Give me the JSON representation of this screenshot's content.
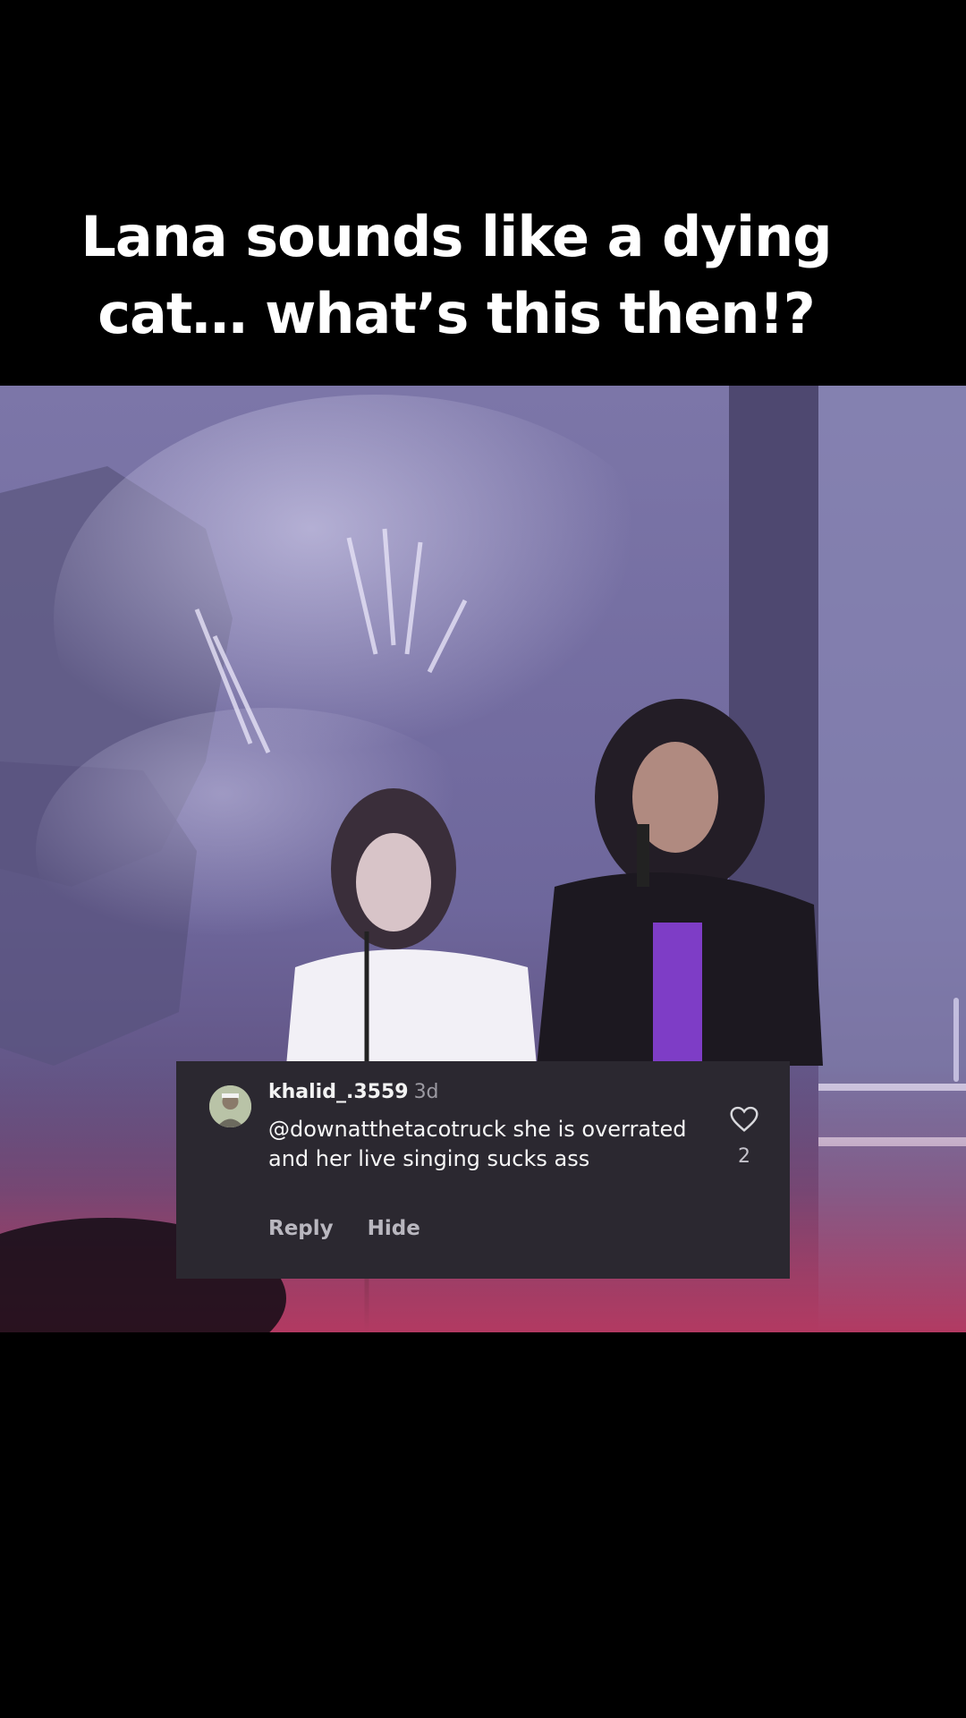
{
  "overlay": {
    "caption": "Lana sounds like a dying cat… what’s this then!?"
  },
  "video": {
    "dominant_color": "#6b6494",
    "description_icon": "concert-video-frame"
  },
  "comment": {
    "username": "khalid_.3559",
    "time": "3d",
    "text": "@downatthetacotruck she is overrated and her live singing sucks ass",
    "reply_label": "Reply",
    "hide_label": "Hide",
    "like_count": "2",
    "like_icon": "heart-outline-icon",
    "avatar_icon": "user-avatar"
  },
  "colors": {
    "background": "#000000",
    "comment_card": "#2b2830",
    "caption_text": "#ffffff",
    "muted_text": "#9c9aa2"
  }
}
